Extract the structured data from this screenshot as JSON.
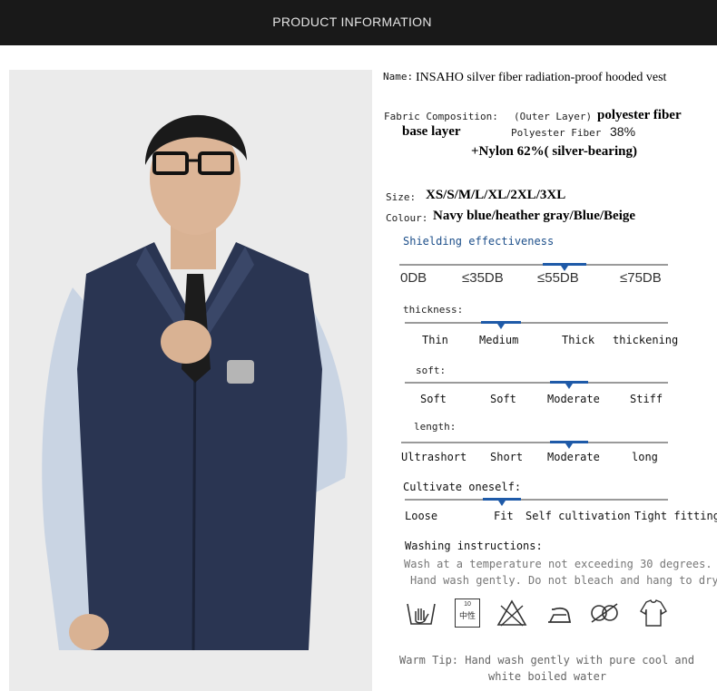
{
  "header": {
    "title": "PRODUCT INFORMATION"
  },
  "product": {
    "name_label": "Name:",
    "name_value": "INSAHO silver fiber radiation-proof  hooded vest",
    "fabric_label": "Fabric Composition:",
    "outer_prefix": "(Outer Layer)",
    "outer_value": "polyester fiber",
    "base_label": "base layer",
    "base_fiber_label": "Polyester Fiber",
    "base_fiber_value": "38%",
    "nylon_value": "+Nylon 62%( silver-bearing)",
    "size_label": "Size:",
    "size_value": "XS/S/M/L/XL/2XL/3XL",
    "colour_label": "Colour:",
    "colour_value": "Navy blue/heather gray/Blue/Beige"
  },
  "shielding": {
    "title": "Shielding effectiveness",
    "options": [
      "0DB",
      "≤35DB",
      "≤55DB",
      "≤75DB"
    ],
    "selected": "≤55DB"
  },
  "thickness": {
    "label": "thickness:",
    "options": [
      "Thin",
      "Medium",
      "Thick",
      "thickening"
    ],
    "selected": "Medium"
  },
  "soft": {
    "label": "soft:",
    "options": [
      "Soft",
      "Soft",
      "Moderate",
      "Stiff"
    ],
    "selected": "Moderate"
  },
  "length": {
    "label": "length:",
    "options": [
      "Ultrashort",
      "Short",
      "Moderate",
      "long"
    ],
    "selected": "Moderate"
  },
  "fit": {
    "label": "Cultivate oneself:",
    "options": [
      "Loose",
      "Fit",
      "Self cultivation",
      "Tight fitting"
    ],
    "selected": "Fit"
  },
  "washing": {
    "title": "Washing instructions:",
    "line1": "Wash at a temperature not exceeding 30 degrees.",
    "line2": "Hand wash gently. Do not bleach and hang to dry.",
    "icons": [
      "hand-wash-icon",
      "wash-temperature-icon",
      "no-bleach-icon",
      "iron-icon",
      "no-tumble-dry-icon",
      "hang-dry-icon"
    ],
    "temp_icon_number": "10",
    "temp_icon_text": "中性"
  },
  "tip": {
    "line1": "Warm Tip: Hand wash gently with pure cool and",
    "line2": "white boiled water"
  },
  "colors": {
    "banner": "#191919",
    "accent": "#1e5aa8",
    "vest": "#2a3552",
    "shirt": "#c9d4e3"
  }
}
